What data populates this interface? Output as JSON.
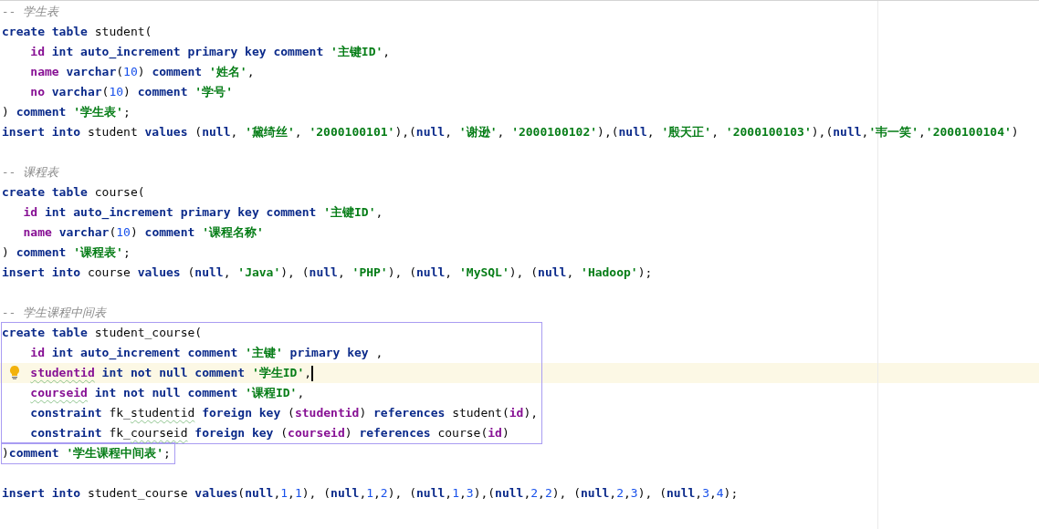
{
  "editor": {
    "blocks": [
      {
        "outlined": false,
        "lines": [
          {
            "kind": "code",
            "tokens": [
              {
                "kind": "cmt",
                "t": "-- 学生表"
              }
            ]
          },
          {
            "kind": "code",
            "tokens": [
              {
                "kind": "kw",
                "t": "create table "
              },
              {
                "kind": "plain",
                "t": "student("
              }
            ]
          },
          {
            "kind": "code",
            "tokens": [
              {
                "kind": "col",
                "t": "    id "
              },
              {
                "kind": "kw",
                "t": "int auto_increment primary key comment "
              },
              {
                "kind": "str",
                "t": "'主键ID'"
              },
              {
                "kind": "plain",
                "t": ","
              }
            ]
          },
          {
            "kind": "code",
            "tokens": [
              {
                "kind": "col",
                "t": "    name "
              },
              {
                "kind": "kw",
                "t": "varchar"
              },
              {
                "kind": "plain",
                "t": "("
              },
              {
                "kind": "num",
                "t": "10"
              },
              {
                "kind": "plain",
                "t": ") "
              },
              {
                "kind": "kw",
                "t": "comment "
              },
              {
                "kind": "str",
                "t": "'姓名'"
              },
              {
                "kind": "plain",
                "t": ","
              }
            ]
          },
          {
            "kind": "code",
            "tokens": [
              {
                "kind": "col",
                "t": "    no "
              },
              {
                "kind": "kw",
                "t": "varchar"
              },
              {
                "kind": "plain",
                "t": "("
              },
              {
                "kind": "num",
                "t": "10"
              },
              {
                "kind": "plain",
                "t": ") "
              },
              {
                "kind": "kw",
                "t": "comment "
              },
              {
                "kind": "str",
                "t": "'学号'"
              }
            ]
          },
          {
            "kind": "code",
            "tokens": [
              {
                "kind": "plain",
                "t": ") "
              },
              {
                "kind": "kw",
                "t": "comment "
              },
              {
                "kind": "str",
                "t": "'学生表'"
              },
              {
                "kind": "plain",
                "t": ";"
              }
            ]
          },
          {
            "kind": "code",
            "tokens": [
              {
                "kind": "kw",
                "t": "insert into "
              },
              {
                "kind": "plain",
                "t": "student "
              },
              {
                "kind": "kw",
                "t": "values "
              },
              {
                "kind": "plain",
                "t": "("
              },
              {
                "kind": "kw",
                "t": "null"
              },
              {
                "kind": "plain",
                "t": ", "
              },
              {
                "kind": "str",
                "t": "'黛绮丝'"
              },
              {
                "kind": "plain",
                "t": ", "
              },
              {
                "kind": "str",
                "t": "'2000100101'"
              },
              {
                "kind": "plain",
                "t": "),("
              },
              {
                "kind": "kw",
                "t": "null"
              },
              {
                "kind": "plain",
                "t": ", "
              },
              {
                "kind": "str",
                "t": "'谢逊'"
              },
              {
                "kind": "plain",
                "t": ", "
              },
              {
                "kind": "str",
                "t": "'2000100102'"
              },
              {
                "kind": "plain",
                "t": "),("
              },
              {
                "kind": "kw",
                "t": "null"
              },
              {
                "kind": "plain",
                "t": ", "
              },
              {
                "kind": "str",
                "t": "'殷天正'"
              },
              {
                "kind": "plain",
                "t": ", "
              },
              {
                "kind": "str",
                "t": "'2000100103'"
              },
              {
                "kind": "plain",
                "t": "),("
              },
              {
                "kind": "kw",
                "t": "null"
              },
              {
                "kind": "plain",
                "t": ","
              },
              {
                "kind": "str",
                "t": "'韦一笑'"
              },
              {
                "kind": "plain",
                "t": ","
              },
              {
                "kind": "str",
                "t": "'2000100104'"
              },
              {
                "kind": "plain",
                "t": ")"
              }
            ]
          },
          {
            "kind": "blank"
          },
          {
            "kind": "code",
            "tokens": [
              {
                "kind": "cmt",
                "t": "-- 课程表"
              }
            ]
          },
          {
            "kind": "code",
            "tokens": [
              {
                "kind": "kw",
                "t": "create table "
              },
              {
                "kind": "plain",
                "t": "course("
              }
            ]
          },
          {
            "kind": "code",
            "tokens": [
              {
                "kind": "col",
                "t": "   id "
              },
              {
                "kind": "kw",
                "t": "int auto_increment primary key comment "
              },
              {
                "kind": "str",
                "t": "'主键ID'"
              },
              {
                "kind": "plain",
                "t": ","
              }
            ]
          },
          {
            "kind": "code",
            "tokens": [
              {
                "kind": "col",
                "t": "   name "
              },
              {
                "kind": "kw",
                "t": "varchar"
              },
              {
                "kind": "plain",
                "t": "("
              },
              {
                "kind": "num",
                "t": "10"
              },
              {
                "kind": "plain",
                "t": ") "
              },
              {
                "kind": "kw",
                "t": "comment "
              },
              {
                "kind": "str",
                "t": "'课程名称'"
              }
            ]
          },
          {
            "kind": "code",
            "tokens": [
              {
                "kind": "plain",
                "t": ") "
              },
              {
                "kind": "kw",
                "t": "comment "
              },
              {
                "kind": "str",
                "t": "'课程表'"
              },
              {
                "kind": "plain",
                "t": ";"
              }
            ]
          },
          {
            "kind": "code",
            "tokens": [
              {
                "kind": "kw",
                "t": "insert into "
              },
              {
                "kind": "plain",
                "t": "course "
              },
              {
                "kind": "kw",
                "t": "values "
              },
              {
                "kind": "plain",
                "t": "("
              },
              {
                "kind": "kw",
                "t": "null"
              },
              {
                "kind": "plain",
                "t": ", "
              },
              {
                "kind": "str",
                "t": "'Java'"
              },
              {
                "kind": "plain",
                "t": "), ("
              },
              {
                "kind": "kw",
                "t": "null"
              },
              {
                "kind": "plain",
                "t": ", "
              },
              {
                "kind": "str",
                "t": "'PHP'"
              },
              {
                "kind": "plain",
                "t": "), ("
              },
              {
                "kind": "kw",
                "t": "null"
              },
              {
                "kind": "plain",
                "t": ", "
              },
              {
                "kind": "str",
                "t": "'MySQL'"
              },
              {
                "kind": "plain",
                "t": "), ("
              },
              {
                "kind": "kw",
                "t": "null"
              },
              {
                "kind": "plain",
                "t": ", "
              },
              {
                "kind": "str",
                "t": "'Hadoop'"
              },
              {
                "kind": "plain",
                "t": ");"
              }
            ]
          },
          {
            "kind": "blank"
          },
          {
            "kind": "code",
            "tokens": [
              {
                "kind": "cmt",
                "t": "-- 学生课程中间表"
              }
            ]
          }
        ]
      },
      {
        "outlined": true,
        "lines": [
          {
            "kind": "code",
            "tokens": [
              {
                "kind": "kw",
                "t": "create table "
              },
              {
                "kind": "plain",
                "t": "student_course("
              }
            ]
          },
          {
            "kind": "code",
            "tokens": [
              {
                "kind": "col",
                "t": "    id "
              },
              {
                "kind": "kw",
                "t": "int auto_increment comment "
              },
              {
                "kind": "str",
                "t": "'主键'"
              },
              {
                "kind": "kw",
                "t": " primary key "
              },
              {
                "kind": "plain",
                "t": ","
              }
            ]
          },
          {
            "kind": "code",
            "current": true,
            "bulb": true,
            "caret": true,
            "tokens": [
              {
                "kind": "col",
                "t": "    studentid",
                "warn": true
              },
              {
                "kind": "kw",
                "t": " int not null comment "
              },
              {
                "kind": "str",
                "t": "'学生ID'"
              },
              {
                "kind": "plain",
                "t": ","
              }
            ]
          },
          {
            "kind": "code",
            "tokens": [
              {
                "kind": "col",
                "t": "    courseid",
                "warn": true
              },
              {
                "kind": "kw",
                "t": " int not null comment "
              },
              {
                "kind": "str",
                "t": "'课程ID'"
              },
              {
                "kind": "plain",
                "t": ","
              }
            ]
          },
          {
            "kind": "code",
            "tokens": [
              {
                "kind": "kw",
                "t": "    constraint "
              },
              {
                "kind": "plain",
                "t": "fk_"
              },
              {
                "kind": "plain",
                "t": "studentid",
                "warn": true
              },
              {
                "kind": "kw",
                "t": " foreign key "
              },
              {
                "kind": "plain",
                "t": "("
              },
              {
                "kind": "col",
                "t": "studentid"
              },
              {
                "kind": "plain",
                "t": ") "
              },
              {
                "kind": "kw",
                "t": "references "
              },
              {
                "kind": "plain",
                "t": "student("
              },
              {
                "kind": "col",
                "t": "id"
              },
              {
                "kind": "plain",
                "t": "),"
              }
            ]
          },
          {
            "kind": "code",
            "tokens": [
              {
                "kind": "kw",
                "t": "    constraint "
              },
              {
                "kind": "plain",
                "t": "fk_"
              },
              {
                "kind": "plain",
                "t": "courseid",
                "warn": true
              },
              {
                "kind": "kw",
                "t": " foreign key "
              },
              {
                "kind": "plain",
                "t": "("
              },
              {
                "kind": "col",
                "t": "courseid"
              },
              {
                "kind": "plain",
                "t": ") "
              },
              {
                "kind": "kw",
                "t": "references "
              },
              {
                "kind": "plain",
                "t": "course("
              },
              {
                "kind": "col",
                "t": "id"
              },
              {
                "kind": "plain",
                "t": ")"
              }
            ]
          }
        ]
      },
      {
        "outlined": true,
        "lines": [
          {
            "kind": "code",
            "tokens": [
              {
                "kind": "plain",
                "t": ")"
              },
              {
                "kind": "kw",
                "t": "comment "
              },
              {
                "kind": "str",
                "t": "'学生课程中间表'"
              },
              {
                "kind": "plain",
                "t": ";"
              }
            ]
          }
        ]
      },
      {
        "outlined": false,
        "lines": [
          {
            "kind": "blank"
          },
          {
            "kind": "code",
            "tokens": [
              {
                "kind": "kw",
                "t": "insert into "
              },
              {
                "kind": "plain",
                "t": "student_course "
              },
              {
                "kind": "kw",
                "t": "values"
              },
              {
                "kind": "plain",
                "t": "("
              },
              {
                "kind": "kw",
                "t": "null"
              },
              {
                "kind": "plain",
                "t": ","
              },
              {
                "kind": "num",
                "t": "1"
              },
              {
                "kind": "plain",
                "t": ","
              },
              {
                "kind": "num",
                "t": "1"
              },
              {
                "kind": "plain",
                "t": "), ("
              },
              {
                "kind": "kw",
                "t": "null"
              },
              {
                "kind": "plain",
                "t": ","
              },
              {
                "kind": "num",
                "t": "1"
              },
              {
                "kind": "plain",
                "t": ","
              },
              {
                "kind": "num",
                "t": "2"
              },
              {
                "kind": "plain",
                "t": "), ("
              },
              {
                "kind": "kw",
                "t": "null"
              },
              {
                "kind": "plain",
                "t": ","
              },
              {
                "kind": "num",
                "t": "1"
              },
              {
                "kind": "plain",
                "t": ","
              },
              {
                "kind": "num",
                "t": "3"
              },
              {
                "kind": "plain",
                "t": "),("
              },
              {
                "kind": "kw",
                "t": "null"
              },
              {
                "kind": "plain",
                "t": ","
              },
              {
                "kind": "num",
                "t": "2"
              },
              {
                "kind": "plain",
                "t": ","
              },
              {
                "kind": "num",
                "t": "2"
              },
              {
                "kind": "plain",
                "t": "), ("
              },
              {
                "kind": "kw",
                "t": "null"
              },
              {
                "kind": "plain",
                "t": ","
              },
              {
                "kind": "num",
                "t": "2"
              },
              {
                "kind": "plain",
                "t": ","
              },
              {
                "kind": "num",
                "t": "3"
              },
              {
                "kind": "plain",
                "t": "), ("
              },
              {
                "kind": "kw",
                "t": "null"
              },
              {
                "kind": "plain",
                "t": ","
              },
              {
                "kind": "num",
                "t": "3"
              },
              {
                "kind": "plain",
                "t": ","
              },
              {
                "kind": "num",
                "t": "4"
              },
              {
                "kind": "plain",
                "t": ");"
              }
            ]
          }
        ]
      }
    ]
  }
}
